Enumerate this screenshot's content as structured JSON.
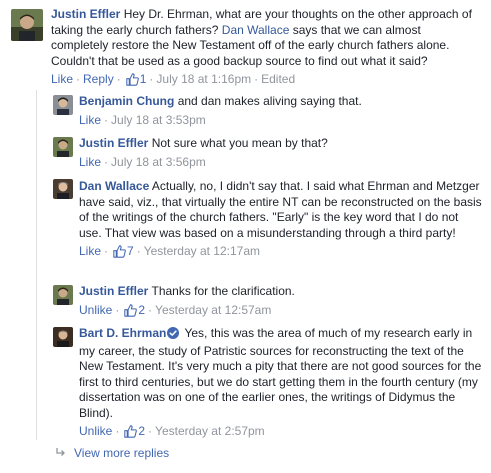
{
  "comments": [
    {
      "author": "Justin Effler",
      "text_before": "Hey Dr. Ehrman, what are your thoughts on the other approach of taking the early church fathers?",
      "mention": "Dan Wallace",
      "text_after": "says that we can almost completely restore the New Testament off of the early church fathers alone. Couldn't that be used as a good backup source to find out what it said?",
      "action": "Like",
      "reply": "Reply",
      "likes": "1",
      "time": "July 18 at 1:16pm",
      "edited": "Edited"
    },
    {
      "author": "Benjamin Chung",
      "text": "and dan makes aliving saying that.",
      "action": "Like",
      "time": "July 18 at 3:53pm"
    },
    {
      "author": "Justin Effler",
      "text": "Not sure what you mean by that?",
      "action": "Like",
      "time": "July 18 at 3:56pm"
    },
    {
      "author": "Dan Wallace",
      "text": "Actually, no, I didn't say that. I said what Ehrman and Metzger have said, viz., that virtually the entire NT can be reconstructed on the basis of the writings of the church fathers. \"Early\" is the key word that I do not use. That view was based on a misunderstanding through a third party!",
      "action": "Like",
      "likes": "7",
      "time": "Yesterday at 12:17am"
    },
    {
      "author": "Justin Effler",
      "text": "Thanks for the clarification.",
      "action": "Unlike",
      "likes": "2",
      "time": "Yesterday at 12:57am"
    },
    {
      "author": "Bart D. Ehrman",
      "text": "Yes, this was the area of much of my research early in my career, the study of Patristic sources for reconstructing the text of the New Testament. It's very much a pity that there are not good sources for the first to third centuries, but we do start getting them in the fourth century (my dissertation was on one of the earlier ones, the writings of Didymus the Blind).",
      "action": "Unlike",
      "likes": "2",
      "time": "Yesterday at 2:57pm"
    }
  ],
  "view_more": "View more replies",
  "colors": {
    "link": "#365899",
    "action": "#4267b2",
    "meta": "#90949c",
    "verified": "#4267b2"
  }
}
